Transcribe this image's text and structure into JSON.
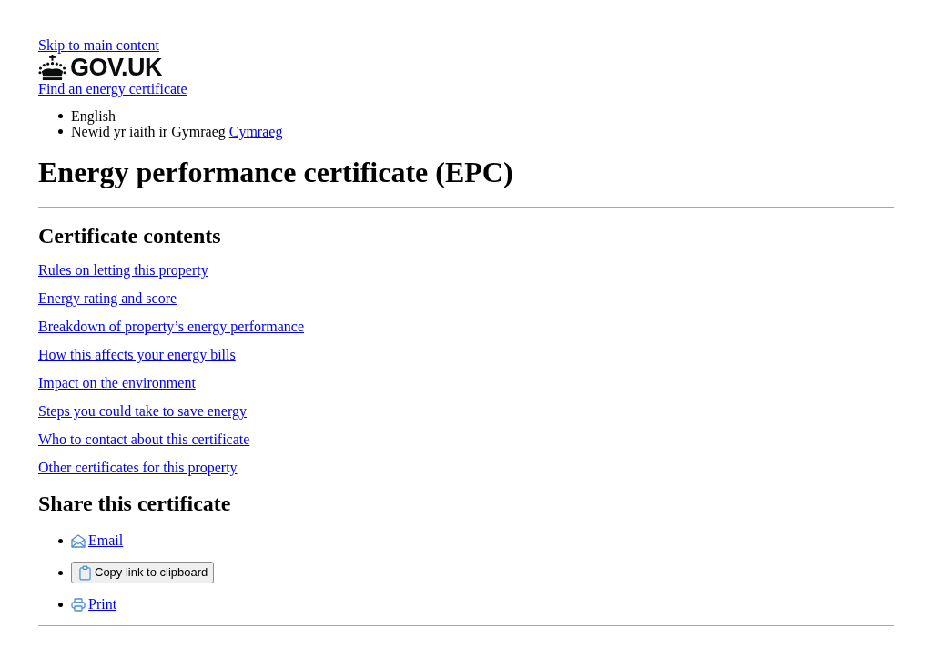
{
  "skip_link": "Skip to main content",
  "header": {
    "logo_text": "GOV.UK",
    "service_link": "Find an energy certificate"
  },
  "language_list": [
    {
      "kind": "plain",
      "text": "English"
    },
    {
      "kind": "linked",
      "text": "Newid yr iaith ir Gymraeg",
      "link": "Cymraeg"
    }
  ],
  "title": "Energy performance certificate (EPC)",
  "contents": {
    "heading": "Certificate contents",
    "links": [
      "Rules on letting this property",
      "Energy rating and score",
      "Breakdown of property’s energy performance",
      "How this affects your energy bills",
      "Impact on the environment",
      "Steps you could take to save energy",
      "Who to contact about this certificate",
      "Other certificates for this property"
    ]
  },
  "share": {
    "heading": "Share this certificate",
    "items": [
      {
        "kind": "email",
        "label": "Email"
      },
      {
        "kind": "clipboard",
        "label": "Copy link to clipboard"
      },
      {
        "kind": "print",
        "label": "Print"
      }
    ]
  }
}
